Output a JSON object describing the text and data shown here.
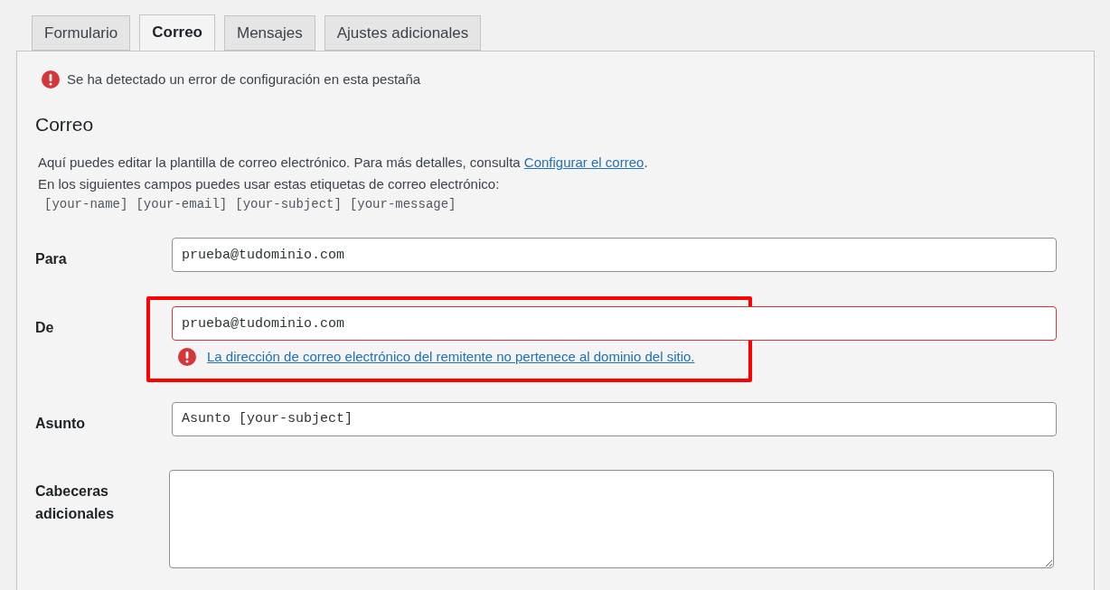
{
  "tabs": [
    {
      "label": "Formulario",
      "selected": false
    },
    {
      "label": "Correo",
      "selected": true
    },
    {
      "label": "Mensajes",
      "selected": false
    },
    {
      "label": "Ajustes adicionales",
      "selected": false
    }
  ],
  "notice": "Se ha detectado un error de configuración en esta pestaña",
  "heading": "Correo",
  "description": {
    "text": "Aquí puedes editar la plantilla de correo electrónico. Para más detalles, consulta ",
    "link": "Configurar el correo",
    "after": "."
  },
  "tags_intro": "En los siguientes campos puedes usar estas etiquetas de correo electrónico:",
  "tags": [
    "[your-name]",
    "[your-email]",
    "[your-subject]",
    "[your-message]"
  ],
  "fields": [
    {
      "label": "Para",
      "kind": "input",
      "value": "prueba@tudominio.com"
    },
    {
      "label": "De",
      "kind": "input",
      "value": "prueba@tudominio.com",
      "error": true,
      "error_message": "La dirección de correo electrónico del remitente no pertenece al dominio del sitio.",
      "highlighted": true
    },
    {
      "label": "Asunto",
      "kind": "input",
      "value": "Asunto [your-subject]"
    },
    {
      "label": "Cabeceras adicionales",
      "kind": "textarea"
    }
  ]
}
